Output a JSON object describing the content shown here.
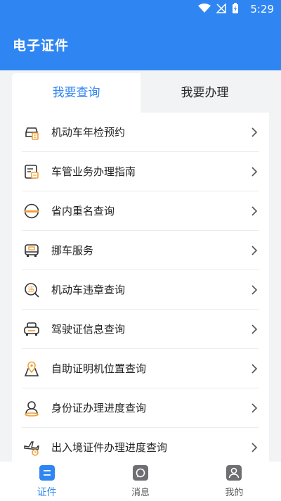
{
  "status_bar": {
    "time": "5:29",
    "icons": [
      "wifi-icon",
      "signal-icon",
      "battery-icon"
    ]
  },
  "app_bar": {
    "title": "电子证件"
  },
  "tabs": [
    {
      "label": "我要查询",
      "active": true
    },
    {
      "label": "我要办理",
      "active": false
    }
  ],
  "list": [
    {
      "label": "机动车年检预约",
      "icon": "car-inspection-icon"
    },
    {
      "label": "车管业务办理指南",
      "icon": "guide-icon"
    },
    {
      "label": "省内重名查询",
      "icon": "name-search-icon"
    },
    {
      "label": "挪车服务",
      "icon": "move-car-icon"
    },
    {
      "label": "机动车违章查询",
      "icon": "violation-search-icon"
    },
    {
      "label": "驾驶证信息查询",
      "icon": "driver-license-icon"
    },
    {
      "label": "自助证明机位置查询",
      "icon": "location-icon"
    },
    {
      "label": "身份证办理进度查询",
      "icon": "id-card-icon"
    },
    {
      "label": "出入境证件办理进度查询",
      "icon": "airplane-icon"
    }
  ],
  "bottom_nav": [
    {
      "label": "证件",
      "icon": "document-icon",
      "active": true
    },
    {
      "label": "消息",
      "icon": "message-icon",
      "active": false
    },
    {
      "label": "我的",
      "icon": "profile-icon",
      "active": false
    }
  ],
  "colors": {
    "primary": "#2f86f2",
    "accent_orange": "#f0a23b",
    "icon_dark": "#333333"
  }
}
